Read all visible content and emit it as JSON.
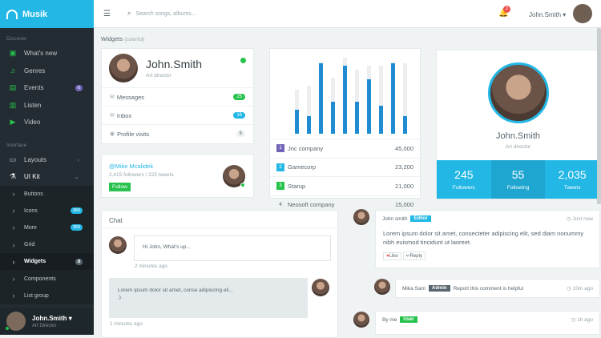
{
  "app": {
    "name": "Musik"
  },
  "sidebar": {
    "section_discover": "Discover",
    "discover": [
      {
        "label": "What's new",
        "icon": "▣"
      },
      {
        "label": "Genres",
        "icon": "♫"
      },
      {
        "label": "Events",
        "icon": "▤",
        "badge": "6"
      },
      {
        "label": "Listen",
        "icon": "▥"
      },
      {
        "label": "Video",
        "icon": "▶"
      }
    ],
    "section_interface": "Interface",
    "layouts": "Layouts",
    "uikit": "UI Kit",
    "sub": [
      {
        "label": "Buttons"
      },
      {
        "label": "Icons",
        "badge": "369"
      },
      {
        "label": "More",
        "badge": "369"
      },
      {
        "label": "Grid"
      },
      {
        "label": "Widgets",
        "badge": "8"
      },
      {
        "label": "Components"
      },
      {
        "label": "List group"
      }
    ],
    "user": {
      "name": "John.Smith",
      "role": "Art Director"
    }
  },
  "header": {
    "search_placeholder": "Search songs, albums...",
    "notif_count": "2",
    "user": "John.Smith"
  },
  "page": {
    "section": "Widgets",
    "section_suffix": "(colorful)"
  },
  "profile": {
    "name": "John.Smith",
    "role": "Art director",
    "rows": [
      {
        "label": "Messages",
        "count": "25"
      },
      {
        "label": "Inbox",
        "count": "16"
      },
      {
        "label": "Profile visits",
        "count": "5"
      }
    ]
  },
  "twitter": {
    "handle": "@Mike Mcalidek",
    "stats": "2,415 followers / 225 tweets",
    "button": "Follow"
  },
  "bars": [
    [
      0.55,
      0.3
    ],
    [
      0.6,
      0.22
    ],
    [
      0.9,
      0.88
    ],
    [
      0.7,
      0.4
    ],
    [
      0.95,
      0.85
    ],
    [
      0.8,
      0.4
    ],
    [
      0.85,
      0.68
    ],
    [
      0.85,
      0.35
    ],
    [
      0.9,
      0.88
    ],
    [
      0.88,
      0.22
    ]
  ],
  "companies": [
    {
      "num": "1",
      "name": "Jnc company",
      "value": "45,000",
      "color": "#7266ba"
    },
    {
      "num": "2",
      "name": "Gamecorp",
      "value": "23,200",
      "color": "#23b7e5"
    },
    {
      "num": "3",
      "name": "Starup",
      "value": "21,000",
      "color": "#27c24c"
    },
    {
      "num": "4",
      "name": "Neosoft company",
      "value": "15,000",
      "color": "#edf1f2"
    }
  ],
  "bigprofile": {
    "name": "John.Smith",
    "role": "Art director",
    "stats": [
      {
        "n": "245",
        "l": "Followers",
        "color": "#23b7e5"
      },
      {
        "n": "55",
        "l": "Following",
        "color": "#1fa6d0"
      },
      {
        "n": "2,035",
        "l": "Tweets",
        "color": "#23b7e5"
      }
    ]
  },
  "chat": {
    "title": "Chat",
    "msg1": "Hi John, What's up...",
    "time1": "2 minutes ago",
    "msg2": "Lorem ipsum dolor sit amet, conse adipiscing eli...",
    "msg2b": ":)",
    "time2": "1 minutes ago"
  },
  "comments": {
    "c1": {
      "user": "John smith",
      "label": "Editor",
      "time": "Just now",
      "body": "Lorem ipsum dolor sit amet, consecteter adipiscing elit, sed diam nonummy nibh euismod tincidunt ut laoreet.",
      "like": "Like",
      "reply": "Reply"
    },
    "c2": {
      "user": "Mika Sam",
      "label": "Admin",
      "text": "Report this comment is helpful",
      "time": "10m ago"
    },
    "c3": {
      "user": "By me",
      "label": "User",
      "time": "1h ago"
    }
  }
}
